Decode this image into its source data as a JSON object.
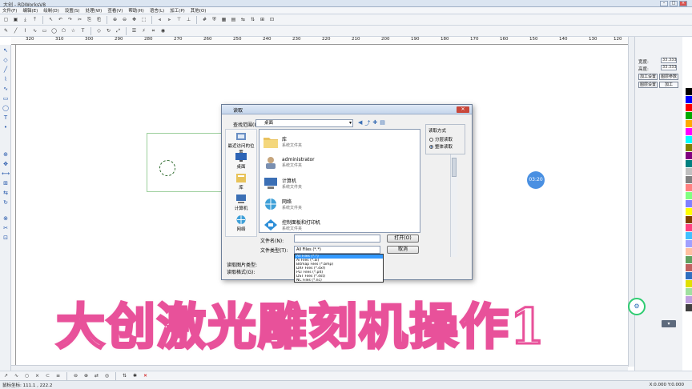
{
  "window": {
    "title": "大创 - RDWorksV8"
  },
  "menu": [
    "文件(F)",
    "编辑(E)",
    "绘制(D)",
    "设置(S)",
    "处理(W)",
    "查看(V)",
    "帮助(H)",
    "语言(L)",
    "加工(P)",
    "其他(O)"
  ],
  "ruler_top": [
    "320",
    "310",
    "300",
    "290",
    "280",
    "270",
    "260",
    "250",
    "240",
    "230",
    "220",
    "210",
    "200",
    "190",
    "180",
    "170",
    "160",
    "150",
    "140",
    "130",
    "120"
  ],
  "right_panel": {
    "rows": [
      {
        "label": "宽度:",
        "value": "33.333"
      },
      {
        "label": "高度:",
        "value": "33.333"
      }
    ],
    "buttons": [
      "加工设置",
      "图层参数",
      "图层设置",
      "加工"
    ]
  },
  "palette": [
    "#000000",
    "#0000ff",
    "#ff0000",
    "#00aa00",
    "#ffaa00",
    "#ff00ff",
    "#00ffff",
    "#808000",
    "#800080",
    "#008080",
    "#c0c0c0",
    "#808080",
    "#ff8080",
    "#80ff80",
    "#8080ff",
    "#ffff00",
    "#804000",
    "#ff4080",
    "#40c0ff",
    "#a0a0ff",
    "#ffc0a0",
    "#60a060",
    "#c06060",
    "#3070c0",
    "#e0e000",
    "#a0e0a0",
    "#c0a0e0",
    "#404040"
  ],
  "dialog": {
    "title": "读取",
    "lookin_label": "查找范围(I):",
    "lookin_value": "桌面",
    "places": [
      "最近访问的位置",
      "桌面",
      "库",
      "计算机",
      "网络"
    ],
    "files": [
      {
        "name": "库",
        "sub": "系统文件夹"
      },
      {
        "name": "administrator",
        "sub": "系统文件夹"
      },
      {
        "name": "计算机",
        "sub": "系统文件夹"
      },
      {
        "name": "网络",
        "sub": "系统文件夹"
      },
      {
        "name": "控制面板和打印机",
        "sub": "系统文件夹"
      }
    ],
    "preview_title": "读取方式",
    "radio_1": "分层读取",
    "radio_2": "整体读取",
    "filename_label": "文件名(N):",
    "filename_value": "",
    "filetype_label": "文件类型(T):",
    "filetype_value": "All Files (*.*)",
    "open_btn": "打开(O)",
    "cancel_btn": "取消",
    "filetype_options": [
      "All Files (*.*)",
      "Ai Files (*.ai)",
      "Bitmap Files (*.bmp)",
      "DXF Files (*.dxf)",
      "PLT Files (*.plt)",
      "DST Files (*.dst)",
      "NC Files (*.nc)"
    ],
    "info1_label": "读取图片类型:",
    "info2_label": "读取格式(G):"
  },
  "canvas": {
    "badge": "03:20"
  },
  "watermark": "大创激光雕刻机操作1",
  "statusbar": {
    "left": "鼠标坐标: 111.1 , 222.2",
    "right": "X:0.000 Y:0.000"
  }
}
